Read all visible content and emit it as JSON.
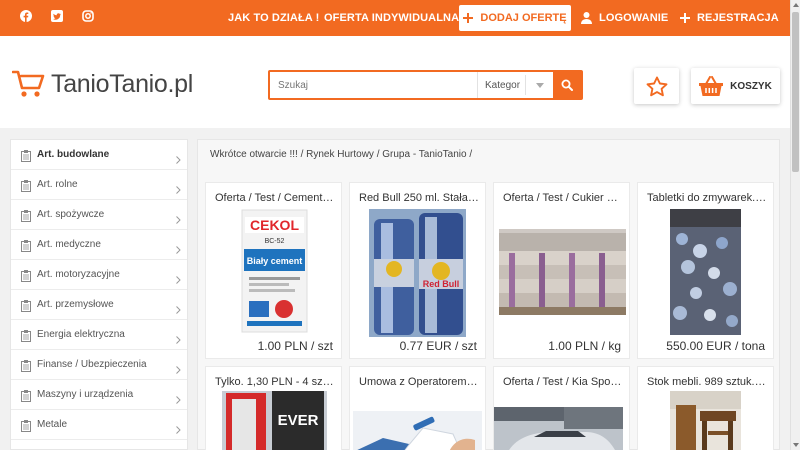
{
  "brand": {
    "accent": "#f26a21",
    "logo_text": "TanioTanio.pl"
  },
  "topbar": {
    "social": [
      "facebook-icon",
      "twitter-icon",
      "instagram-icon"
    ],
    "how_it_works": "JAK TO DZIAŁA !",
    "individual_offer": "OFERTA INDYWIDUALNA",
    "add_offer": "DODAJ OFERTĘ",
    "login": "LOGOWANIE",
    "register": "REJESTRACJA"
  },
  "search": {
    "placeholder": "Szukaj",
    "category": "Kategor"
  },
  "header": {
    "cart_label": "KOSZYK"
  },
  "sidebar": {
    "items": [
      {
        "label": "Art. budowlane"
      },
      {
        "label": "Art. rolne"
      },
      {
        "label": "Art. spożywcze"
      },
      {
        "label": "Art. medyczne"
      },
      {
        "label": "Art. motoryzacyjne"
      },
      {
        "label": "Art. przemysłowe"
      },
      {
        "label": "Energia elektryczna"
      },
      {
        "label": "Finanse / Ubezpieczenia"
      },
      {
        "label": "Maszyny i urządzenia"
      },
      {
        "label": "Metale"
      }
    ]
  },
  "main": {
    "breadcrumb": "Wkrótce otwarcie !!! / Rynek Hurtowy / Grupa - TanioTanio /",
    "products": [
      {
        "title": "Oferta / Test / Cement …",
        "price": "1.00 PLN / szt",
        "image_texts": [
          "CEKOL",
          "BC-52",
          "Biały cement"
        ]
      },
      {
        "title": "Red Bull 250 ml. Stała …",
        "price": "0.77 EUR / szt",
        "image_texts": [
          "Red Bull"
        ]
      },
      {
        "title": "Oferta / Test / Cukier b…",
        "price": "1.00 PLN / kg"
      },
      {
        "title": "Tabletki do zmywarek. …",
        "price": "550.00 EUR / tona"
      },
      {
        "title": "Tylko. 1,30 PLN - 4 szt.…",
        "image_texts": [
          "EVER"
        ]
      },
      {
        "title": "Umowa z Operatorem …"
      },
      {
        "title": "Oferta / Test / Kia Spor…"
      },
      {
        "title": "Stok mebli. 989 sztuk. …"
      }
    ]
  }
}
